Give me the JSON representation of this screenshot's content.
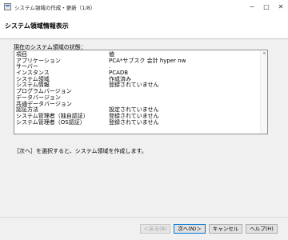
{
  "window": {
    "title": "システム領域の作成・更新（1/8）",
    "controls": {
      "minimize": "−",
      "maximize": "□",
      "close": "✕"
    }
  },
  "header": {
    "title": "システム領域情報表示"
  },
  "status": {
    "label": "現在のシステム領域の状態：",
    "rows": [
      {
        "item": "項目",
        "value": "値"
      },
      {
        "item": "アプリケーション",
        "value": "PCA*サブスク 会計 hyper nw"
      },
      {
        "item": "サーバー",
        "value": "."
      },
      {
        "item": "インスタンス",
        "value": "PCADB"
      },
      {
        "item": "システム領域",
        "value": "作成済み"
      },
      {
        "item": "システム情報",
        "value": "登録されていません"
      },
      {
        "item": "プログラムバージョン",
        "value": ""
      },
      {
        "item": "データバージョン",
        "value": ""
      },
      {
        "item": "共通データバージョン",
        "value": ""
      },
      {
        "item": "認証方法",
        "value": "設定されていません"
      },
      {
        "item": "システム管理者（独自認証）",
        "value": "登録されていません"
      },
      {
        "item": "システム管理者（OS認証）",
        "value": "登録されていません"
      }
    ]
  },
  "instruction": "［次へ］を選択すると、システム領域を作成します。",
  "buttons": {
    "back": "＜戻る(B)",
    "next": "次へ(N)＞",
    "cancel": "キャンセル",
    "help": "ヘルプ(H)"
  }
}
